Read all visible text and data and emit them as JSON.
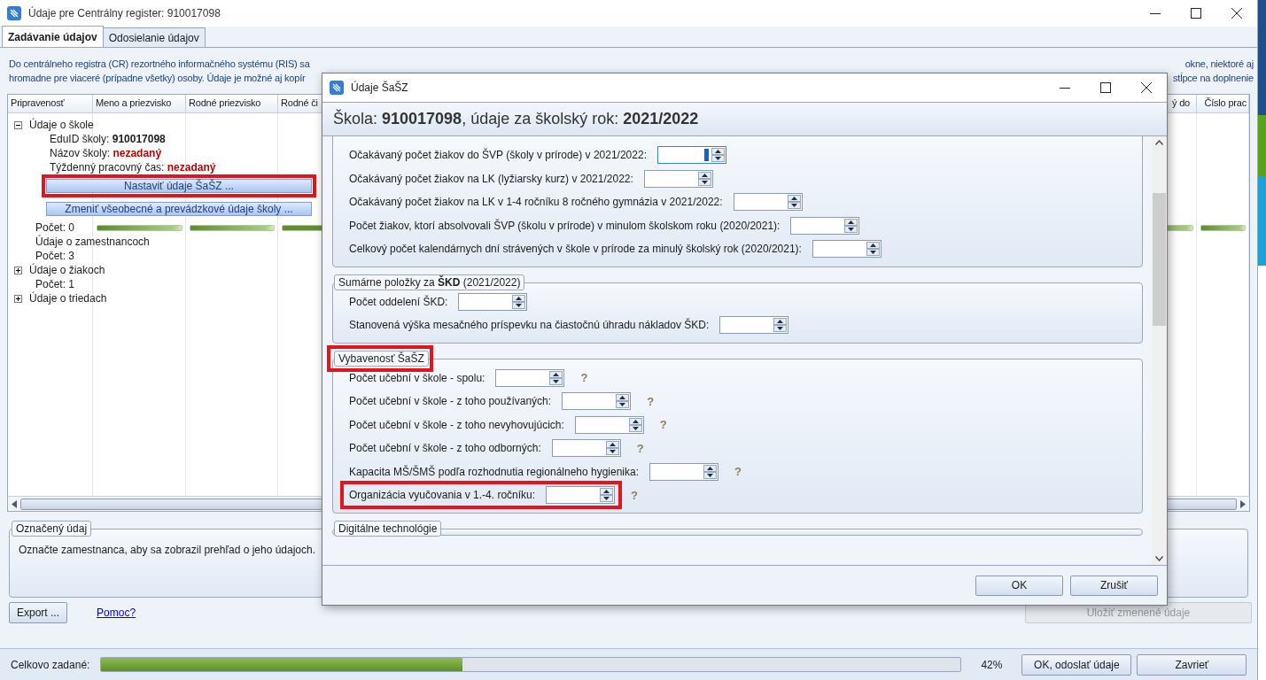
{
  "window": {
    "title": "Údaje pre Centrálny register: 910017098"
  },
  "tabs": [
    {
      "label": "Zadávanie údajov",
      "selected": true
    },
    {
      "label": "Odosielanie údajov",
      "selected": false
    }
  ],
  "description": {
    "line_1_start": "Do centrálneho registra (CR) rezortného informačného systému (RIS) sa",
    "line_1_end": "okne, niektoré aj",
    "line_2_start": "hromadne pre viaceré (prípadne všetky) osoby. Údaje je možné aj kopír",
    "line_2_end": "stĺpce na doplnenie"
  },
  "table": {
    "columns": [
      "Pripravenosť",
      "Meno a priezvisko",
      "Rodné priezvisko",
      "Rodné či",
      "ý do",
      "Číslo prac"
    ],
    "tree": [
      {
        "kind": "node",
        "label": "Údaje o škole",
        "expanded": true,
        "children": [
          {
            "kind": "field",
            "label": "EduID školy:",
            "value": "910017098",
            "missing": false
          },
          {
            "kind": "field",
            "label": "Názov školy:",
            "value": "nezadaný",
            "missing": true
          },
          {
            "kind": "field",
            "label": "Týždenný pracovný čas:",
            "value": "nezadaný",
            "missing": true
          },
          {
            "kind": "button",
            "label": "Nastaviť údaje ŠaŠZ ...",
            "highlighted": true
          },
          {
            "kind": "button",
            "label": "Zmeniť všeobecné a prevádzkové údaje školy ...",
            "highlighted": false
          }
        ]
      },
      {
        "kind": "count",
        "label": "Počet: 0",
        "bars": [
          {
            "level": 1
          },
          {
            "level": 1
          },
          {
            "level": 1
          },
          {
            "level": 1
          },
          {
            "level": 1
          }
        ]
      },
      {
        "kind": "node",
        "label": "Údaje o zamestnancoch"
      },
      {
        "kind": "count",
        "label": "Počet: 3"
      },
      {
        "kind": "node",
        "label": "Údaje o žiakoch",
        "expanded": false
      },
      {
        "kind": "count",
        "label": "Počet: 1"
      },
      {
        "kind": "node",
        "label": "Údaje o triedach",
        "expanded": false
      }
    ]
  },
  "selected_info": {
    "legend": "Označený údaj",
    "text": "Označte zamestnanca, aby sa zobrazil prehľad o jeho údajoch."
  },
  "actions": {
    "export": "Export ...",
    "help_link": "Pomoc?",
    "save": {
      "label": "Uložiť zmenené údaje",
      "disabled": true
    }
  },
  "status_bar": {
    "label": "Celkovo zadané:",
    "level": 0.42,
    "percent": "42%",
    "buttons": [
      "OK, odoslať údaje",
      "Zavrieť"
    ]
  },
  "dialog": {
    "title": "Údaje ŠaŠZ",
    "header": "Škola: **910017098**, údaje za školský rok: **2021/2022**",
    "groups": [
      {
        "rows": [
          {
            "label": "Očakávaný počet žiakov do ŠVP (školy v prírode) v 2021/2022:",
            "focused": true,
            "highlighted": false
          },
          {
            "label": "Očakávaný počet žiakov na LK (lyžiarsky kurz) v 2021/2022:",
            "focused": false,
            "highlighted": false
          },
          {
            "label": "Očakávaný počet žiakov na LK v 1-4 ročníku 8 ročného gymnázia v 2021/2022:",
            "focused": false,
            "highlighted": false
          },
          {
            "label": "Počet žiakov, ktorí absolvovali ŠVP (školu v prírode) v minulom školskom roku (2020/2021):",
            "focused": false,
            "highlighted": false
          },
          {
            "label": "Celkový počet kalendárnych dní strávených v škole v prírode za minulý školský rok (2020/2021):",
            "focused": false,
            "highlighted": false
          }
        ]
      },
      {
        "legend": "Sumárne položky za **ŠKD** (2021/2022)",
        "highlighted": false,
        "rows": [
          {
            "label": "Počet oddelení ŠKD:",
            "focused": false,
            "highlighted": false
          },
          {
            "label": "Stanovená výška mesačného príspevku na čiastočnú úhradu nákladov ŠKD:",
            "focused": false,
            "highlighted": false
          }
        ]
      },
      {
        "legend": "Vybavenosť ŠaŠZ",
        "highlighted": true,
        "rows": [
          {
            "label": "Počet učební v škole - spolu:",
            "focused": false,
            "highlighted": false,
            "help": "?"
          },
          {
            "label": "Počet učební v škole - z toho používaných:",
            "focused": false,
            "highlighted": false,
            "help": "?"
          },
          {
            "label": "Počet učební v škole - z toho nevyhovujúcich:",
            "focused": false,
            "highlighted": false,
            "help": "?"
          },
          {
            "label": "Počet učební v škole - z toho odborných:",
            "focused": false,
            "highlighted": false,
            "help": "?"
          },
          {
            "label": "Kapacita MŠ/ŠMŠ podľa rozhodnutia regionálneho hygienika:",
            "focused": false,
            "highlighted": false,
            "help": "?"
          },
          {
            "label": "Organizácia vyučovania v 1.-4. ročníku:",
            "focused": false,
            "highlighted": true,
            "help": "?"
          }
        ]
      },
      {
        "legend": "Digitálne technológie",
        "highlighted": false
      }
    ],
    "buttons": [
      "OK",
      "Zrušiť"
    ]
  }
}
